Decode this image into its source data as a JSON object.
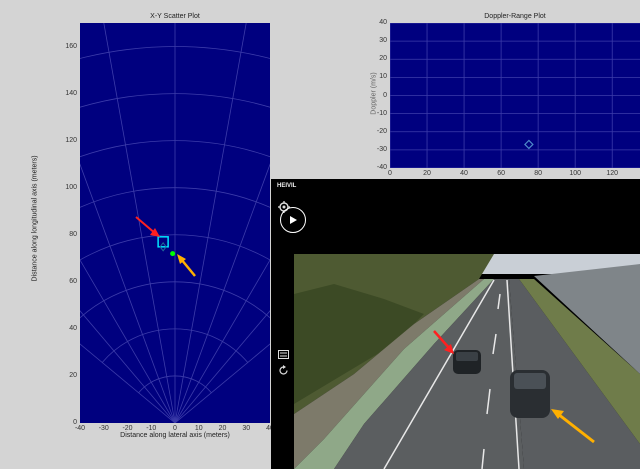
{
  "scatter_plot": {
    "title": "X-Y Scatter Plot",
    "xlabel": "Distance along lateral axis (meters)",
    "ylabel": "Distance along longitudinal axis (meters)",
    "x_ticks": [
      "-40",
      "-30",
      "-20",
      "-10",
      "0",
      "10",
      "20",
      "30",
      "40"
    ],
    "y_ticks": [
      "160",
      "140",
      "120",
      "100",
      "80",
      "60",
      "40",
      "20",
      "0"
    ]
  },
  "doppler_plot": {
    "title": "Doppler-Range Plot",
    "ylabel": "Doppler (m/s)",
    "y_ticks": [
      "40",
      "30",
      "20",
      "10",
      "0",
      "-10",
      "-20",
      "-30",
      "-40"
    ],
    "x_ticks": [
      "0",
      "20",
      "40",
      "60",
      "80",
      "100",
      "120"
    ]
  },
  "video_panel": {
    "logo_text": "HEIVIL"
  },
  "colors": {
    "plot_bg": "#00007f",
    "target_box": "#00e5ff",
    "detection_point": "#00ff00",
    "arrow_red": "#ff2020",
    "arrow_orange": "#ffb000"
  },
  "chart_data": [
    {
      "type": "scatter",
      "title": "X-Y Scatter Plot",
      "xlabel": "Distance along lateral axis (meters)",
      "ylabel": "Distance along longitudinal axis (meters)",
      "xlim": [
        -40,
        40
      ],
      "ylim": [
        0,
        170
      ],
      "grid": "polar",
      "points": [
        {
          "x": -5,
          "y": 77
        },
        {
          "x": -1,
          "y": 72
        }
      ]
    },
    {
      "type": "scatter",
      "title": "Doppler-Range Plot",
      "xlabel": "",
      "ylabel": "Doppler (m/s)",
      "xlim": [
        0,
        135
      ],
      "ylim": [
        -40,
        40
      ],
      "grid": true,
      "points": [
        {
          "x": 75,
          "y": -27
        }
      ]
    }
  ]
}
